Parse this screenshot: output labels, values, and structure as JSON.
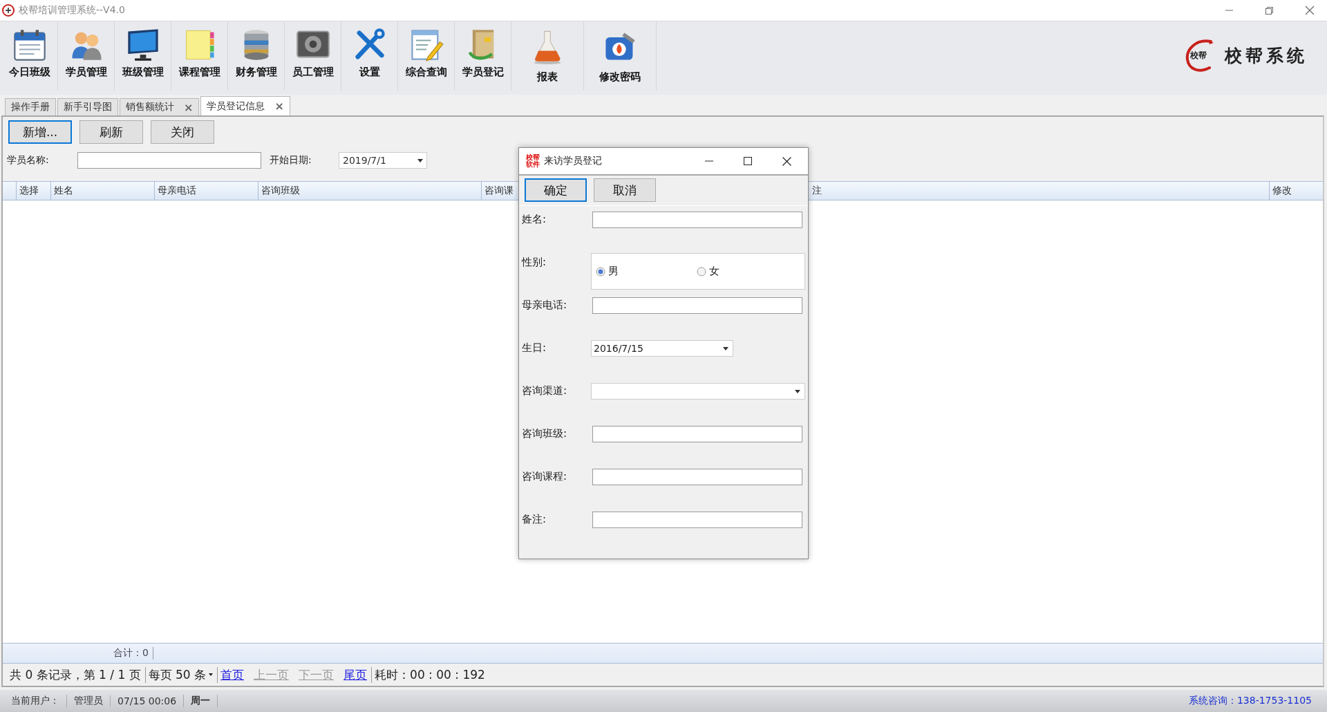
{
  "window": {
    "title": "校帮培训管理系统--V4.0"
  },
  "toolbar": [
    {
      "label": "今日班级"
    },
    {
      "label": "学员管理"
    },
    {
      "label": "班级管理"
    },
    {
      "label": "课程管理"
    },
    {
      "label": "财务管理"
    },
    {
      "label": "员工管理"
    },
    {
      "label": "设置"
    },
    {
      "label": "综合查询"
    },
    {
      "label": "学员登记"
    },
    {
      "label": "报表"
    },
    {
      "label": "修改密码"
    }
  ],
  "logo": {
    "seal": "校帮",
    "name": "校帮系统"
  },
  "tabs": [
    {
      "label": "操作手册",
      "selected": false
    },
    {
      "label": "新手引导图",
      "selected": false
    },
    {
      "label": "销售额统计",
      "selected": false,
      "close": "×"
    },
    {
      "label": "学员登记信息",
      "selected": true,
      "close": "×"
    }
  ],
  "actions": [
    {
      "label": "新增...",
      "default": true
    },
    {
      "label": "刷新",
      "default": false
    },
    {
      "label": "关闭",
      "default": false
    }
  ],
  "filters": {
    "name_label": "学员名称:",
    "date_label": "开始日期:",
    "date_value": "2019/7/1"
  },
  "table": {
    "columns": [
      "选择",
      "姓名",
      "母亲电话",
      "咨询班级",
      "咨询课",
      "注",
      "修改"
    ]
  },
  "summary": "合计：0",
  "pager": {
    "info": "共 0 条记录，第 1 / 1 页",
    "page_size": "每页 50 条",
    "links": [
      {
        "label": "首页",
        "disabled": false
      },
      {
        "label": "上一页",
        "disabled": true
      },
      {
        "label": "下一页",
        "disabled": true
      },
      {
        "label": "尾页",
        "disabled": false
      }
    ],
    "elapsed": "耗时：00 : 00 : 192"
  },
  "status_bar": {
    "user_label": "当前用户：",
    "user": "管理员",
    "time": "07/15 00:06",
    "weekday": "周一",
    "contact": "系统咨询：138-1753-1105"
  },
  "dialog": {
    "logo": "校帮软件",
    "title": "来访学员登记",
    "buttons": [
      {
        "label": "确定",
        "default": true
      },
      {
        "label": "取消",
        "default": false
      }
    ],
    "fields": [
      {
        "kind": "text",
        "label": "姓名:"
      },
      {
        "kind": "radio",
        "label": "性别:",
        "options": [
          {
            "label": "男",
            "selected": true
          },
          {
            "label": "女",
            "selected": false
          }
        ]
      },
      {
        "kind": "text",
        "label": "母亲电话:"
      },
      {
        "kind": "date",
        "label": "生日:",
        "value": "2016/7/15"
      },
      {
        "kind": "select",
        "label": "咨询渠道:"
      },
      {
        "kind": "text",
        "label": "咨询班级:"
      },
      {
        "kind": "text",
        "label": "咨询课程:"
      },
      {
        "kind": "text",
        "label": "备注:"
      }
    ]
  }
}
